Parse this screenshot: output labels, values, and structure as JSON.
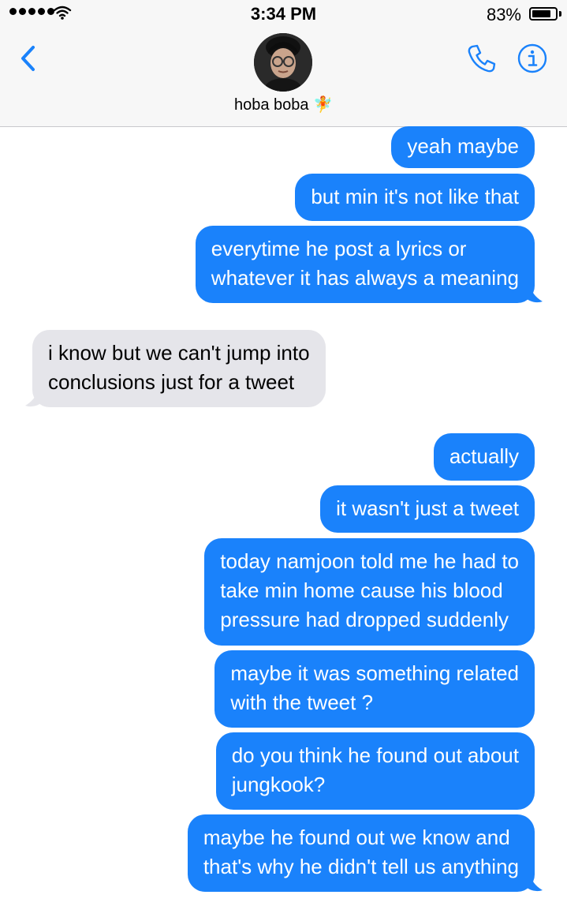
{
  "status_bar": {
    "time": "3:34 PM",
    "battery_percent": "83%",
    "battery_level": 0.83,
    "signal_dots": 5,
    "wifi_icon": "wifi-icon"
  },
  "header": {
    "contact_name": "hoba boba",
    "contact_emoji": "🧚",
    "back_icon": "chevron-left-icon",
    "call_icon": "phone-icon",
    "info_icon": "info-icon",
    "accent_color": "#1a82fb"
  },
  "messages": [
    {
      "from": "me",
      "lines": [
        "yeah maybe"
      ]
    },
    {
      "from": "me",
      "lines": [
        "but min it's not like that"
      ]
    },
    {
      "from": "me",
      "lines": [
        "everytime he post a lyrics or",
        "whatever it has always a meaning"
      ]
    },
    {
      "from": "them",
      "lines": [
        "i know but we can't jump into",
        "conclusions just for a tweet"
      ]
    },
    {
      "from": "me",
      "lines": [
        "actually"
      ]
    },
    {
      "from": "me",
      "lines": [
        "it wasn't just a tweet"
      ]
    },
    {
      "from": "me",
      "lines": [
        "today namjoon told me he had to",
        "take min home cause his blood",
        "pressure had dropped suddenly"
      ]
    },
    {
      "from": "me",
      "lines": [
        "maybe it was something related",
        "with the tweet ?"
      ]
    },
    {
      "from": "me",
      "lines": [
        "do you think he found out about",
        "jungkook?"
      ]
    },
    {
      "from": "me",
      "lines": [
        "maybe he found out we know and",
        "that's why he didn't tell us anything"
      ]
    }
  ],
  "colors": {
    "outgoing_bubble": "#1a82fb",
    "incoming_bubble": "#e5e5ea"
  }
}
